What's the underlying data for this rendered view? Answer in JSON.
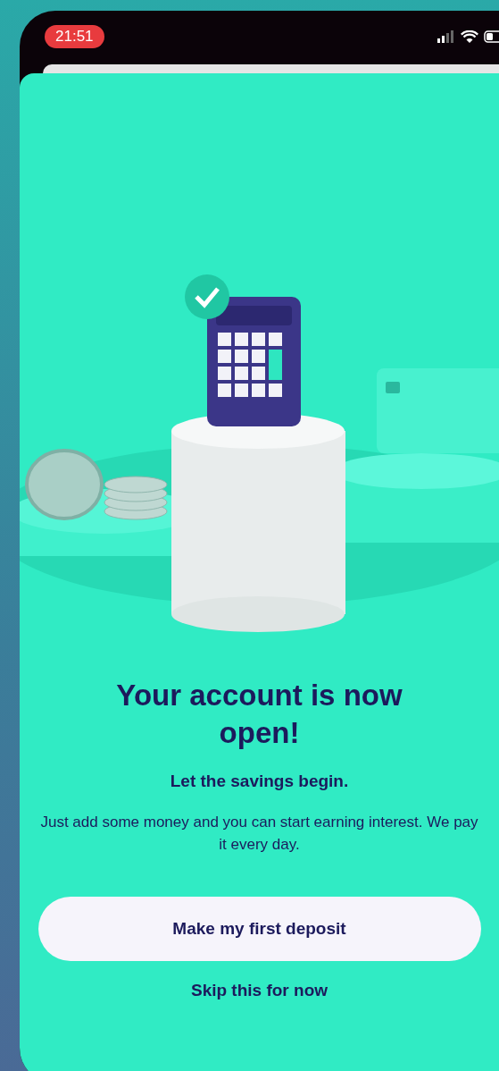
{
  "status_bar": {
    "time": "21:51"
  },
  "heading": "Your account is now open!",
  "subheading": "Let the savings begin.",
  "body": "Just add some money and you can start earning interest. We pay it every day.",
  "primary_button": {
    "label": "Make my first deposit"
  },
  "secondary_link": {
    "label": "Skip this for now"
  }
}
